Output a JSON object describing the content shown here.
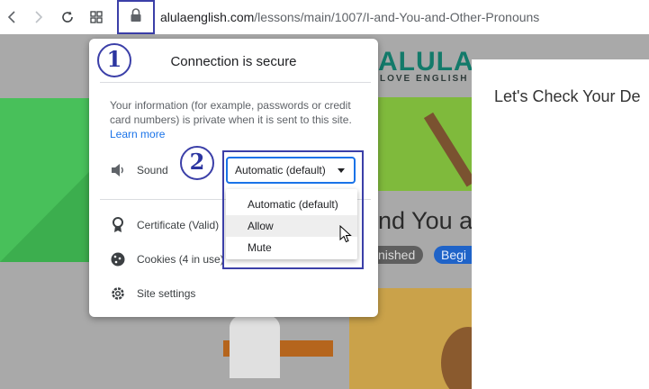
{
  "browser": {
    "url_host": "alulaenglish.com",
    "url_path": "/lessons/main/1007/I-and-You-and-Other-Pronouns",
    "icons": [
      "back-icon",
      "forward-icon",
      "reload-icon",
      "apps-icon",
      "lock-icon"
    ]
  },
  "site_popup": {
    "title": "Connection is secure",
    "info_text": "Your information (for example, passwords or credit card numbers) is private when it is sent to this site.",
    "learn_more": "Learn more",
    "sound_label": "Sound",
    "sound_select_value": "Automatic (default)",
    "sound_options": [
      "Automatic (default)",
      "Allow",
      "Mute"
    ],
    "hovered_option": "Allow",
    "certificate_label": "Certificate (Valid)",
    "cookies_label": "Cookies (4 in use)",
    "site_settings_label": "Site settings"
  },
  "annotations": {
    "step1": "1",
    "step2": "2",
    "highlight_color": "#3b3fa8"
  },
  "page": {
    "logo": "ALULA",
    "logo_sub": "LOVE ENGLISH",
    "lesson_title": "nd You a",
    "pill_finished": "nished",
    "pill_begin": "Begi",
    "dialog_title": "Let's Check Your De"
  }
}
